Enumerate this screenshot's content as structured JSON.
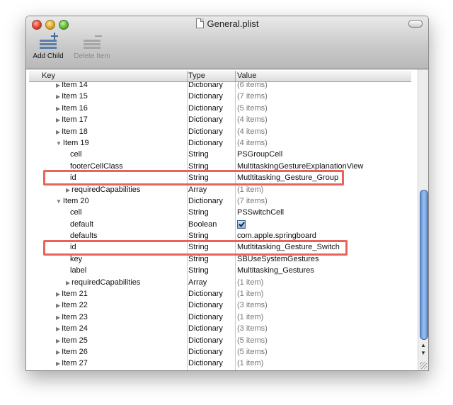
{
  "window": {
    "title": "General.plist"
  },
  "toolbar": {
    "add_child_label": "Add Child",
    "delete_item_label": "Delete Item"
  },
  "table": {
    "columns": [
      "Key",
      "Type",
      "Value"
    ],
    "rows": [
      {
        "key": "Item 14",
        "type": "Dictionary",
        "value": "(6 items)"
      },
      {
        "key": "Item 15",
        "type": "Dictionary",
        "value": "(7 items)"
      },
      {
        "key": "Item 16",
        "type": "Dictionary",
        "value": "(5 items)"
      },
      {
        "key": "Item 17",
        "type": "Dictionary",
        "value": "(4 items)"
      },
      {
        "key": "Item 18",
        "type": "Dictionary",
        "value": "(4 items)"
      },
      {
        "key": "Item 19",
        "type": "Dictionary",
        "value": "(4 items)"
      },
      {
        "key": "cell",
        "type": "String",
        "value": "PSGroupCell"
      },
      {
        "key": "footerCellClass",
        "type": "String",
        "value": "MultitaskingGestureExplanationView"
      },
      {
        "key": "id",
        "type": "String",
        "value": "Mutltitasking_Gesture_Group"
      },
      {
        "key": "requiredCapabilities",
        "type": "Array",
        "value": "(1 item)"
      },
      {
        "key": "Item 20",
        "type": "Dictionary",
        "value": "(7 items)"
      },
      {
        "key": "cell",
        "type": "String",
        "value": "PSSwitchCell"
      },
      {
        "key": "default",
        "type": "Boolean",
        "value": ""
      },
      {
        "key": "defaults",
        "type": "String",
        "value": "com.apple.springboard"
      },
      {
        "key": "id",
        "type": "String",
        "value": "Mutltitasking_Gesture_Switch"
      },
      {
        "key": "key",
        "type": "String",
        "value": "SBUseSystemGestures"
      },
      {
        "key": "label",
        "type": "String",
        "value": "Multitasking_Gestures"
      },
      {
        "key": "requiredCapabilities",
        "type": "Array",
        "value": "(1 item)"
      },
      {
        "key": "Item 21",
        "type": "Dictionary",
        "value": "(1 item)"
      },
      {
        "key": "Item 22",
        "type": "Dictionary",
        "value": "(3 items)"
      },
      {
        "key": "Item 23",
        "type": "Dictionary",
        "value": "(1 item)"
      },
      {
        "key": "Item 24",
        "type": "Dictionary",
        "value": "(3 items)"
      },
      {
        "key": "Item 25",
        "type": "Dictionary",
        "value": "(5 items)"
      },
      {
        "key": "Item 26",
        "type": "Dictionary",
        "value": "(5 items)"
      },
      {
        "key": "Item 27",
        "type": "Dictionary",
        "value": "(1 item)"
      }
    ]
  },
  "colors": {
    "highlight": "#e8635a",
    "accent": "#5f8fd3"
  }
}
